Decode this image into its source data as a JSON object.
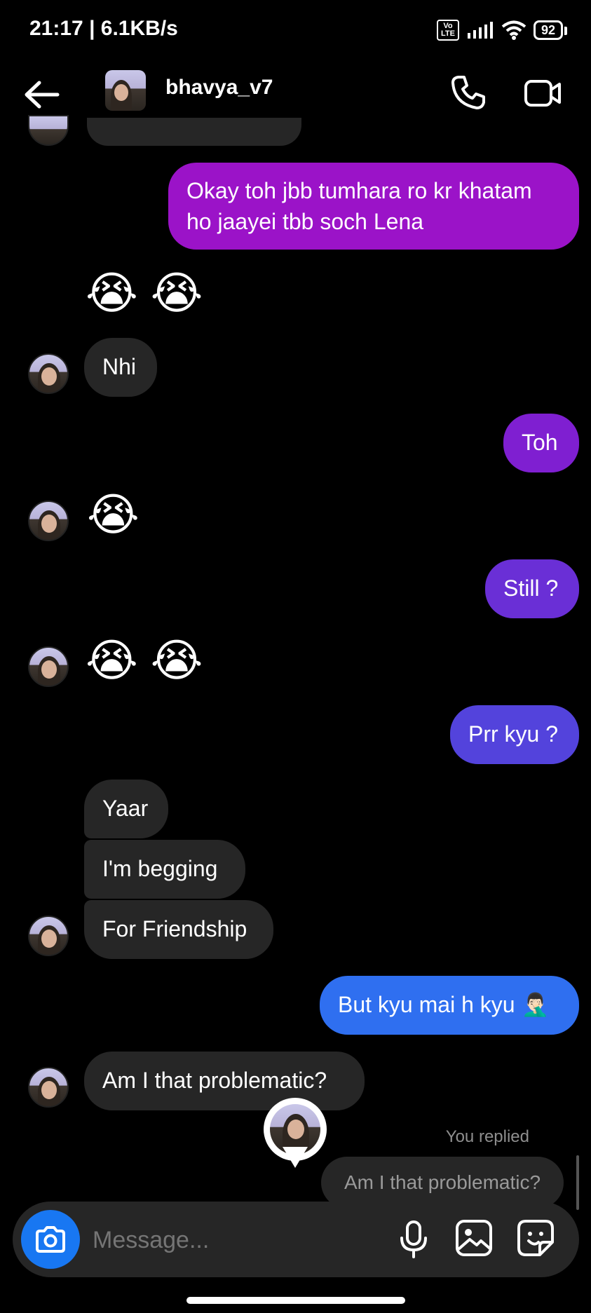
{
  "status": {
    "time": "21:17 | 6.1KB/s",
    "volte": "Vo\nLTE",
    "battery": "92"
  },
  "header": {
    "username": "bhavya_v7"
  },
  "messages": [
    {
      "type": "sent",
      "text": "Okay toh jbb tumhara ro kr khatam ho jaayei tbb soch Lena",
      "color": "#9b13c8"
    },
    {
      "type": "emoji",
      "text": "😭 😭"
    },
    {
      "type": "recv",
      "text": "Nhi"
    },
    {
      "type": "sent",
      "text": "Toh",
      "color": "#7f1fd1"
    },
    {
      "type": "emoji",
      "text": "😭"
    },
    {
      "type": "sent",
      "text": "Still ?",
      "color": "#6a2fd6"
    },
    {
      "type": "emoji",
      "text": "😭 😭"
    },
    {
      "type": "sent",
      "text": "Prr kyu ?",
      "color": "#5343dc"
    },
    {
      "type": "recv",
      "text": "Yaar"
    },
    {
      "type": "recv",
      "text": "I'm begging"
    },
    {
      "type": "recv",
      "text": "For Friendship"
    },
    {
      "type": "sent",
      "text": "But kyu mai h kyu 🤦🏻‍♂️",
      "color": "#2f6ff0"
    },
    {
      "type": "recv",
      "text": "Am I that problematic?"
    }
  ],
  "reply": {
    "label": "You replied",
    "text": "Am I that problematic?"
  },
  "composer": {
    "placeholder": "Message..."
  },
  "icons": {
    "back": "arrow-left-icon",
    "call": "phone-icon",
    "video": "video-camera-icon",
    "camera": "camera-icon",
    "mic": "microphone-icon",
    "gallery": "image-icon",
    "sticker": "sticker-icon"
  }
}
